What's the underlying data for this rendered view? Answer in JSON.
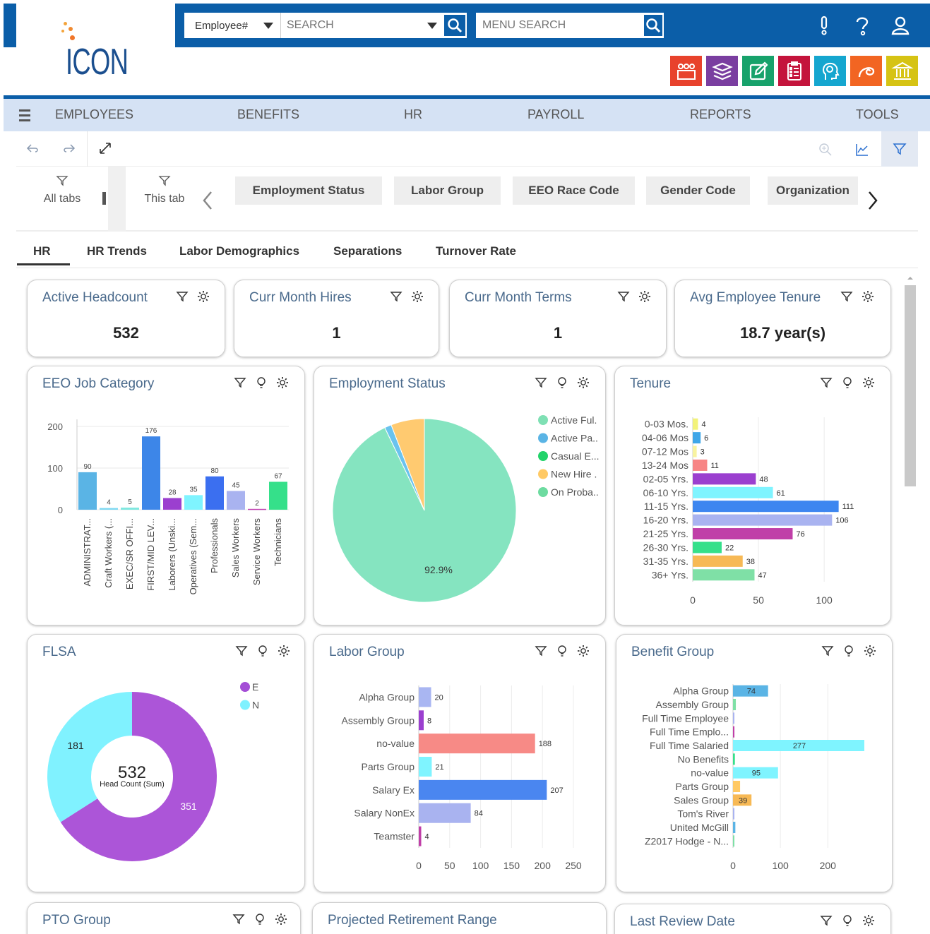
{
  "brand": {
    "logo_text": "ICON"
  },
  "search": {
    "field_selected": "Employee#",
    "placeholder": "SEARCH",
    "menu_placeholder": "MENU SEARCH"
  },
  "colors": {
    "primary": "#0b5ea8",
    "nav_bg": "#d5e2f4",
    "title": "#4a6a8c"
  },
  "modules": [
    {
      "name": "people-icon",
      "color": "#e8422c"
    },
    {
      "name": "stack-icon",
      "color": "#7a3ea0"
    },
    {
      "name": "edit-icon",
      "color": "#17a26b"
    },
    {
      "name": "checklist-icon",
      "color": "#c4143c"
    },
    {
      "name": "brain-icon",
      "color": "#15a6cf"
    },
    {
      "name": "swirl-icon",
      "color": "#f26522"
    },
    {
      "name": "bank-icon",
      "color": "#d6c314"
    }
  ],
  "nav": {
    "employees": "EMPLOYEES",
    "benefits": "BENEFITS",
    "hr": "HR",
    "payroll": "PAYROLL",
    "reports": "REPORTS",
    "tools": "TOOLS"
  },
  "filters": {
    "all_tabs": "All tabs",
    "this_tab": "This tab",
    "chips": [
      "Employment Status",
      "Labor Group",
      "EEO Race Code",
      "Gender Code",
      "Organization"
    ]
  },
  "tabs": [
    "HR",
    "HR Trends",
    "Labor Demographics",
    "Separations",
    "Turnover Rate"
  ],
  "kpis": [
    {
      "title": "Active Headcount",
      "value": "532"
    },
    {
      "title": "Curr Month Hires",
      "value": "1"
    },
    {
      "title": "Curr Month Terms",
      "value": "1"
    },
    {
      "title": "Avg Employee Tenure",
      "value": "18.7 year(s)"
    }
  ],
  "cards": {
    "eeo": "EEO Job Category",
    "emp_status": "Employment Status",
    "tenure": "Tenure",
    "flsa": "FLSA",
    "labor": "Labor Group",
    "benefit": "Benefit Group",
    "pto": "PTO Group",
    "retire": "Projected Retirement Range",
    "review": "Last Review Date"
  },
  "chart_data": [
    {
      "id": "eeo",
      "type": "bar",
      "categories": [
        "ADMINISTRAT...",
        "Craft Workers (...",
        "EXEC/SR OFFI...",
        "FIRST/MID LEV...",
        "Laborers (Unski...",
        "Operatives (Sem...",
        "Professionals",
        "Sales Workers",
        "Service Workers",
        "Technicians"
      ],
      "values": [
        90,
        4,
        5,
        176,
        28,
        35,
        80,
        45,
        2,
        67
      ],
      "colors": [
        "#5ab4e5",
        "#7fd9f2",
        "#7fe8e0",
        "#3d86e8",
        "#9b3fcf",
        "#7ff4ff",
        "#3b6ff0",
        "#a9b3f0",
        "#c03fb0",
        "#35e08a"
      ],
      "yticks": [
        0,
        100,
        200
      ],
      "ylim": [
        0,
        200
      ]
    },
    {
      "id": "emp_status",
      "type": "pie",
      "legend": [
        "Active Ful.",
        "Active Pa..",
        "Casual E...",
        "New Hire .",
        "On Proba.."
      ],
      "legend_colors": [
        "#7fe0b4",
        "#5ab4e5",
        "#22d36a",
        "#ffc964",
        "#6ddba0"
      ],
      "slices": [
        {
          "label": "On Proba..",
          "value": 92.9,
          "color": "#85e4c0"
        },
        {
          "label": "Active Pa..",
          "value": 1.2,
          "color": "#6ac3ee"
        },
        {
          "label": "New Hire .",
          "value": 5.9,
          "color": "#ffca70"
        }
      ],
      "label": "92.9%"
    },
    {
      "id": "tenure",
      "type": "bar",
      "orientation": "horizontal",
      "categories": [
        "0-03 Mos.",
        "04-06 Mos",
        "07-12 Mos",
        "13-24 Mos",
        "02-05 Yrs.",
        "06-10 Yrs.",
        "11-15 Yrs.",
        "16-20 Yrs.",
        "21-25 Yrs.",
        "26-30 Yrs.",
        "31-35 Yrs.",
        "36+ Yrs."
      ],
      "values": [
        4,
        6,
        3,
        11,
        48,
        61,
        111,
        106,
        76,
        22,
        38,
        47
      ],
      "colors": [
        "#f2f27a",
        "#3fa6e8",
        "#f8f3a0",
        "#f78585",
        "#9b3fcf",
        "#7ff4ff",
        "#3d86f0",
        "#a9b3f0",
        "#c03fa8",
        "#35e08a",
        "#f7b955",
        "#7fe0a6"
      ],
      "xticks": [
        0,
        50,
        100
      ],
      "xlim": [
        0,
        130
      ]
    },
    {
      "id": "flsa",
      "type": "donut",
      "legend": [
        "E",
        "N"
      ],
      "legend_colors": [
        "#a44ed6",
        "#7ff1ff"
      ],
      "values": [
        351,
        181
      ],
      "colors": [
        "#ac55d8",
        "#80f2ff"
      ],
      "center_value": "532",
      "center_label": "Head Count (Sum)"
    },
    {
      "id": "labor",
      "type": "bar",
      "orientation": "horizontal",
      "categories": [
        "Alpha Group",
        "Assembly Group",
        "no-value",
        "Parts Group",
        "Salary Ex",
        "Salary NonEx",
        "Teamster"
      ],
      "values": [
        20,
        8,
        188,
        21,
        207,
        84,
        4
      ],
      "colors": [
        "#a9b6f2",
        "#9b3fcf",
        "#f78a86",
        "#7ff4ff",
        "#4a86f0",
        "#a9b3f0",
        "#c03fa8"
      ],
      "xticks": [
        0,
        50,
        100,
        150,
        200,
        250
      ],
      "xlim": [
        0,
        250
      ]
    },
    {
      "id": "benefit",
      "type": "bar",
      "orientation": "horizontal",
      "categories": [
        "Alpha Group",
        "Assembly Group",
        "Full Time Employee",
        "Full Time Emplo...",
        "Full Time Salaried",
        "No Benefits",
        "no-value",
        "Parts Group",
        "Sales Group",
        "Tom's River",
        "United McGill",
        "Z2017 Hodge - N..."
      ],
      "values": [
        74,
        6,
        2,
        3,
        277,
        4,
        95,
        15,
        39,
        2,
        5,
        1
      ],
      "data_labels": [
        "74",
        "",
        "",
        "",
        "277",
        "",
        "95",
        "",
        "39",
        "",
        "",
        ""
      ],
      "colors": [
        "#5ab4e5",
        "#7fe0a6",
        "#a9b3f0",
        "#c03fa8",
        "#7ff4ff",
        "#35e08a",
        "#7ff4ff",
        "#ffc964",
        "#f7b955",
        "#a9b3f0",
        "#5ab4e5",
        "#7fe0a6"
      ],
      "xticks": [
        0,
        100,
        200
      ],
      "xlim": [
        0,
        280
      ]
    }
  ]
}
